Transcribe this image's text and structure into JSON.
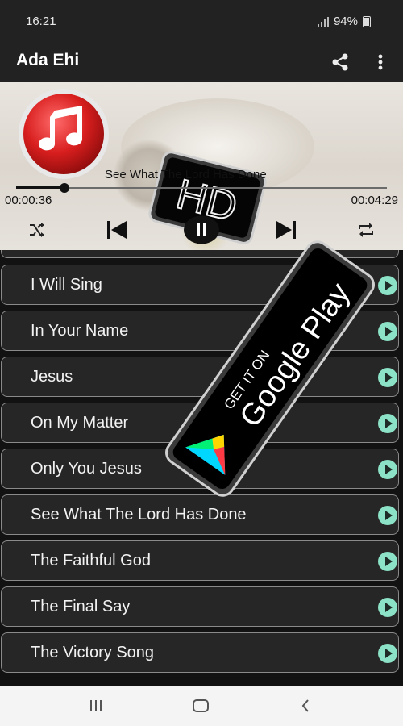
{
  "status_bar": {
    "time": "16:21",
    "battery": "94%"
  },
  "app_bar": {
    "title": "Ada Ehi",
    "actions": [
      "share-icon",
      "more-vertical-icon"
    ]
  },
  "player": {
    "now_playing": "See What The Lord Has Done",
    "elapsed": "00:00:36",
    "duration": "00:04:29",
    "progress": 0.13,
    "state": "playing",
    "badge_text": "HD",
    "controls": [
      "shuffle-icon",
      "skip-previous-icon",
      "pause-icon",
      "skip-next-icon",
      "repeat-icon"
    ]
  },
  "promo": {
    "line1": "GET IT ON",
    "line2": "Google Play"
  },
  "tracks": [
    {
      "title": "I Will Sing"
    },
    {
      "title": "In Your Name"
    },
    {
      "title": "Jesus"
    },
    {
      "title": "On My Matter"
    },
    {
      "title": "Only You Jesus"
    },
    {
      "title": "See What The Lord Has Done"
    },
    {
      "title": "The Faithful God"
    },
    {
      "title": "The Final Say"
    },
    {
      "title": "The Victory Song"
    }
  ],
  "colors": {
    "background": "#121212",
    "app_bar": "#222222",
    "row_background": "#262626",
    "row_border": "#8a8a8a",
    "play_accent": "#8ce2c6",
    "music_icon_red": "#d81e1e",
    "navbar": "#f4f4f4"
  },
  "navigation_bar": [
    "recent-apps-icon",
    "home-icon",
    "back-icon"
  ]
}
